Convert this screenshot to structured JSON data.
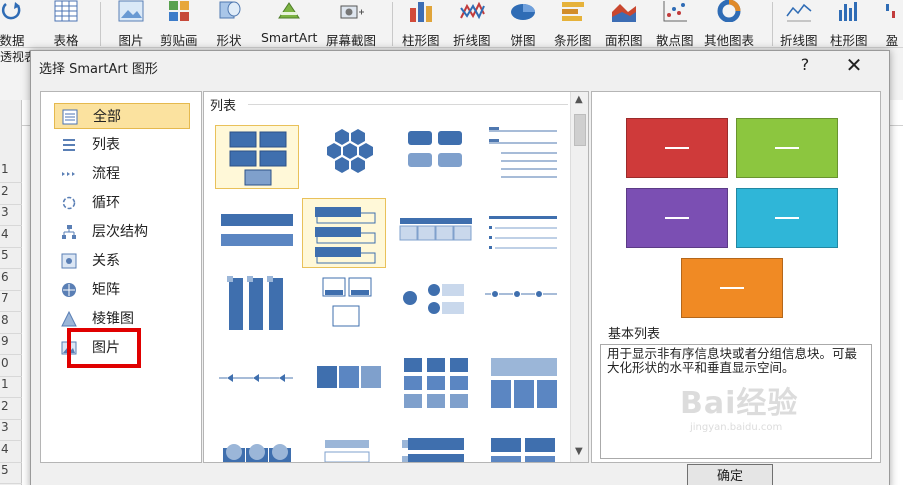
{
  "ribbon": {
    "items": [
      {
        "label": "数据",
        "icon": "refresh-icon"
      },
      {
        "label": "表格",
        "icon": "table-icon"
      },
      {
        "label": "图片",
        "icon": "picture-icon"
      },
      {
        "label": "剪贴画",
        "icon": "clipart-icon"
      },
      {
        "label": "形状",
        "icon": "shapes-icon"
      },
      {
        "label": "SmartArt",
        "icon": "smartart-icon"
      },
      {
        "label": "屏幕截图",
        "icon": "screenshot-icon"
      },
      {
        "label": "柱形图",
        "icon": "column-chart-icon"
      },
      {
        "label": "折线图",
        "icon": "line-chart-icon"
      },
      {
        "label": "饼图",
        "icon": "pie-chart-icon"
      },
      {
        "label": "条形图",
        "icon": "bar-chart-icon"
      },
      {
        "label": "面积图",
        "icon": "area-chart-icon"
      },
      {
        "label": "散点图",
        "icon": "scatter-chart-icon"
      },
      {
        "label": "其他图表",
        "icon": "other-chart-icon"
      },
      {
        "label": "折线图",
        "icon": "sparkline-line-icon"
      },
      {
        "label": "柱形图",
        "icon": "sparkline-column-icon"
      },
      {
        "label": "盈",
        "icon": "sparkline-winloss-icon"
      }
    ],
    "left_label": "透视表"
  },
  "sheet": {
    "rows": [
      "1",
      "2",
      "3",
      "4",
      "5",
      "6",
      "7",
      "8",
      "9",
      "0",
      "1",
      "2",
      "3",
      "4",
      "5"
    ]
  },
  "dialog": {
    "title": "选择 SmartArt 图形",
    "help": "?",
    "close": "✕",
    "categories": [
      {
        "label": "全部",
        "icon": "all-icon"
      },
      {
        "label": "列表",
        "icon": "list-icon"
      },
      {
        "label": "流程",
        "icon": "process-icon"
      },
      {
        "label": "循环",
        "icon": "cycle-icon"
      },
      {
        "label": "层次结构",
        "icon": "hierarchy-icon"
      },
      {
        "label": "关系",
        "icon": "relationship-icon"
      },
      {
        "label": "矩阵",
        "icon": "matrix-icon"
      },
      {
        "label": "棱锥图",
        "icon": "pyramid-icon"
      },
      {
        "label": "图片",
        "icon": "picture-icon"
      }
    ],
    "selected_category": "全部",
    "gallery_heading": "列表",
    "preview": {
      "title": "基本列表",
      "description": "用于显示非有序信息块或者分组信息块。可最大化形状的水平和垂直显示空间。",
      "colors": [
        "#cf3a3a",
        "#8cc63f",
        "#7b4fb3",
        "#2fb6d8",
        "#f08a24"
      ]
    },
    "ok_label": "确定"
  },
  "watermark": {
    "text": "Bai经验",
    "sub": "jingyan.baidu.com"
  }
}
